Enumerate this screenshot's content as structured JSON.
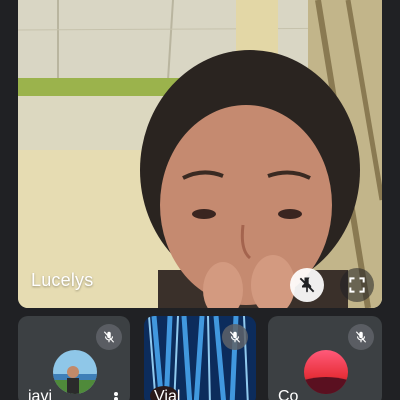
{
  "main_participant": {
    "name": "Lucelys",
    "pin_icon": "pin-off-icon",
    "fullscreen_icon": "fullscreen-icon"
  },
  "participants": [
    {
      "name": "javi",
      "avatar": "avatar-photo",
      "muted": true
    },
    {
      "name": "Vial",
      "avatar": "video-feed",
      "muted": true
    },
    {
      "name": "Co",
      "avatar": "avatar-photo",
      "muted": true
    }
  ],
  "colors": {
    "background": "#202124",
    "tile": "#3c4043",
    "badge": "#5f6368",
    "text": "#ffffff"
  }
}
